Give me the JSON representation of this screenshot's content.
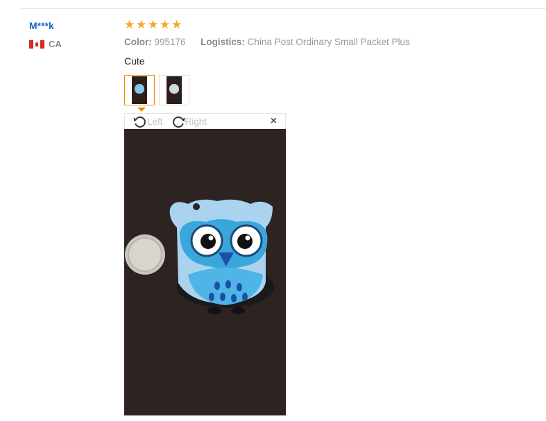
{
  "buyer": {
    "name": "M***k",
    "country": "CA"
  },
  "review": {
    "rating": 5,
    "rating_max": 5,
    "color_label": "Color:",
    "color_value": "995176",
    "logistics_label": "Logistics:",
    "logistics_value": "China Post Ordinary Small Packet Plus",
    "comment": "Cute"
  },
  "viewer": {
    "rotate_left_label": "Left",
    "rotate_right_label": "Right",
    "close_symbol": "×"
  },
  "icons": {
    "star": "star-icon",
    "flag": "canada-flag-icon",
    "rotate_left": "rotate-left-icon",
    "rotate_right": "rotate-right-icon",
    "close": "close-icon"
  },
  "colors": {
    "buyer_name": "#1a66cc",
    "stars": "#f5a623",
    "active_thumb_border": "#f08a00"
  }
}
